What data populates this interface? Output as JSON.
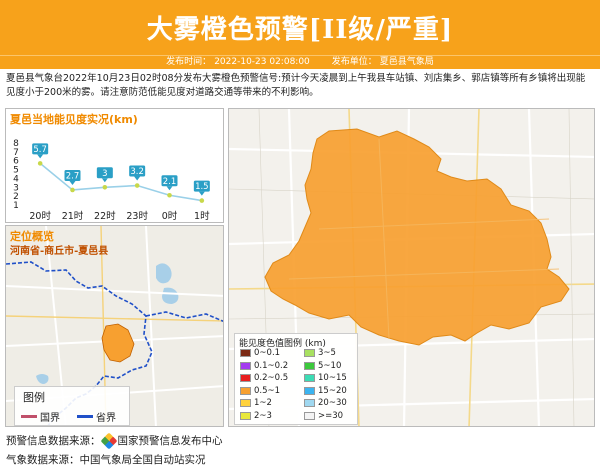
{
  "header": {
    "title": "大雾橙色预警[II级/严重]",
    "publish_time_label": "发布时间：",
    "publish_time": "2022-10-23 02:08:00",
    "publisher_label": "发布单位：",
    "publisher": "夏邑县气象局"
  },
  "description": "夏邑县气象台2022年10月23日02时08分发布大雾橙色预警信号:预计今天凌晨到上午我县车站镇、刘店集乡、郭店镇等所有乡镇将出现能见度小于200米的雾。请注意防范低能见度对道路交通等带来的不利影响。",
  "visibility_panel": {
    "title": "夏邑当地能见度实况(km)"
  },
  "chart_data": {
    "type": "line",
    "title": "夏邑当地能见度实况(km)",
    "categories": [
      "20时",
      "21时",
      "22时",
      "23时",
      "0时",
      "1时"
    ],
    "values": [
      5.7,
      2.7,
      3,
      3.2,
      2.1,
      1.5
    ],
    "value_labels": [
      "5.7",
      "2.7",
      "3",
      "3.2",
      "2.1",
      "1.5"
    ],
    "yticks": [
      "8",
      "7",
      "6",
      "5",
      "4",
      "3",
      "2",
      "1"
    ],
    "ylim": [
      1,
      8
    ],
    "line_color": "#9ad0e8",
    "point_color": "#c8d84a",
    "label_color": "#2a9fc6",
    "grid": false
  },
  "location_panel": {
    "title": "定位概览",
    "subtitle": "河南省-商丘市-夏邑县",
    "legend_title": "图例",
    "legend": [
      {
        "label": "国界",
        "color": "#c0506a"
      },
      {
        "label": "省界",
        "color": "#2050c8"
      }
    ]
  },
  "map_panel": {
    "fill_color": "#f7a030",
    "legend_title": "能见度色值图例 (km)",
    "legend_items": [
      {
        "label": "0~0.1",
        "color": "#7b2a14"
      },
      {
        "label": "0.1~0.2",
        "color": "#a43cf0"
      },
      {
        "label": "0.2~0.5",
        "color": "#e81e1e"
      },
      {
        "label": "0.5~1",
        "color": "#f7a030"
      },
      {
        "label": "1~2",
        "color": "#ffd23c"
      },
      {
        "label": "2~3",
        "color": "#e8e83c"
      },
      {
        "label": "3~5",
        "color": "#a8e060"
      },
      {
        "label": "5~10",
        "color": "#3cc83c"
      },
      {
        "label": "10~15",
        "color": "#3cdcb4"
      },
      {
        "label": "15~20",
        "color": "#3cb4f0"
      },
      {
        "label": "20~30",
        "color": "#a0d8f0"
      },
      {
        "label": ">=30",
        "color": "#f4f4f4"
      }
    ]
  },
  "footer": {
    "warning_source_label": "预警信息数据来源：",
    "warning_source": "国家预警信息发布中心",
    "weather_source_label": "气象数据来源：",
    "weather_source": "中国气象局全国自动站实况"
  }
}
